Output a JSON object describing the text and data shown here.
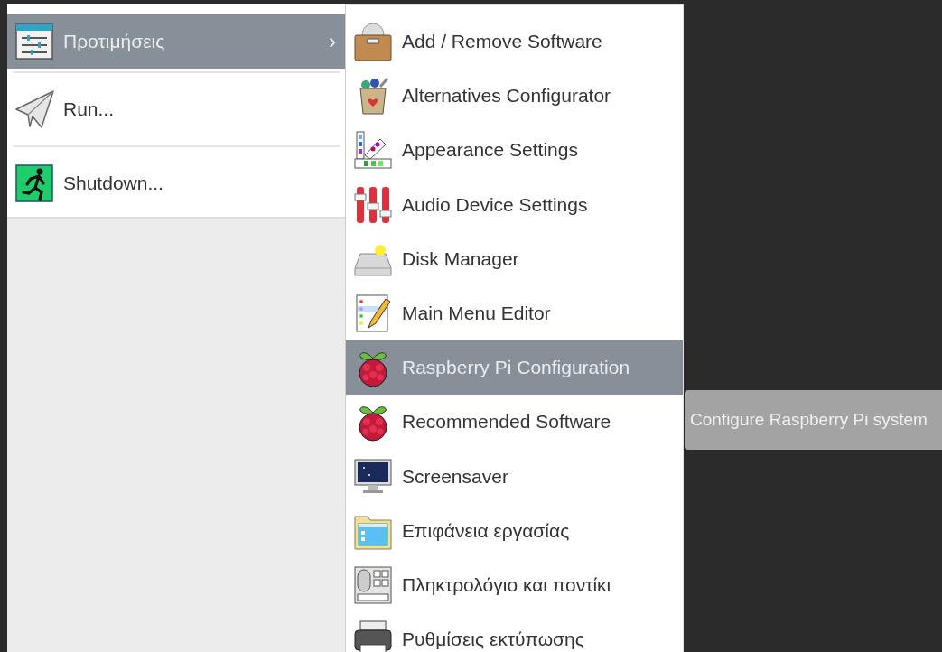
{
  "menu": {
    "items": [
      {
        "label": "Προτιμήσεις",
        "selected": true,
        "arrow": "›"
      },
      {
        "label": "Run...",
        "selected": false
      },
      {
        "label": "Shutdown...",
        "selected": false
      }
    ]
  },
  "submenu": {
    "items": [
      {
        "label": "Add / Remove Software",
        "selected": false
      },
      {
        "label": "Alternatives Configurator",
        "selected": false
      },
      {
        "label": "Appearance Settings",
        "selected": false
      },
      {
        "label": "Audio Device Settings",
        "selected": false
      },
      {
        "label": "Disk Manager",
        "selected": false
      },
      {
        "label": "Main Menu Editor",
        "selected": false
      },
      {
        "label": "Raspberry Pi Configuration",
        "selected": true
      },
      {
        "label": "Recommended Software",
        "selected": false
      },
      {
        "label": "Screensaver",
        "selected": false
      },
      {
        "label": "Επιφάνεια εργασίας",
        "selected": false
      },
      {
        "label": "Πληκτρολόγιο και ποντίκι",
        "selected": false
      },
      {
        "label": "Ρυθμίσεις εκτύπωσης",
        "selected": false
      }
    ]
  },
  "tooltip": {
    "text": "Configure Raspberry Pi system"
  }
}
